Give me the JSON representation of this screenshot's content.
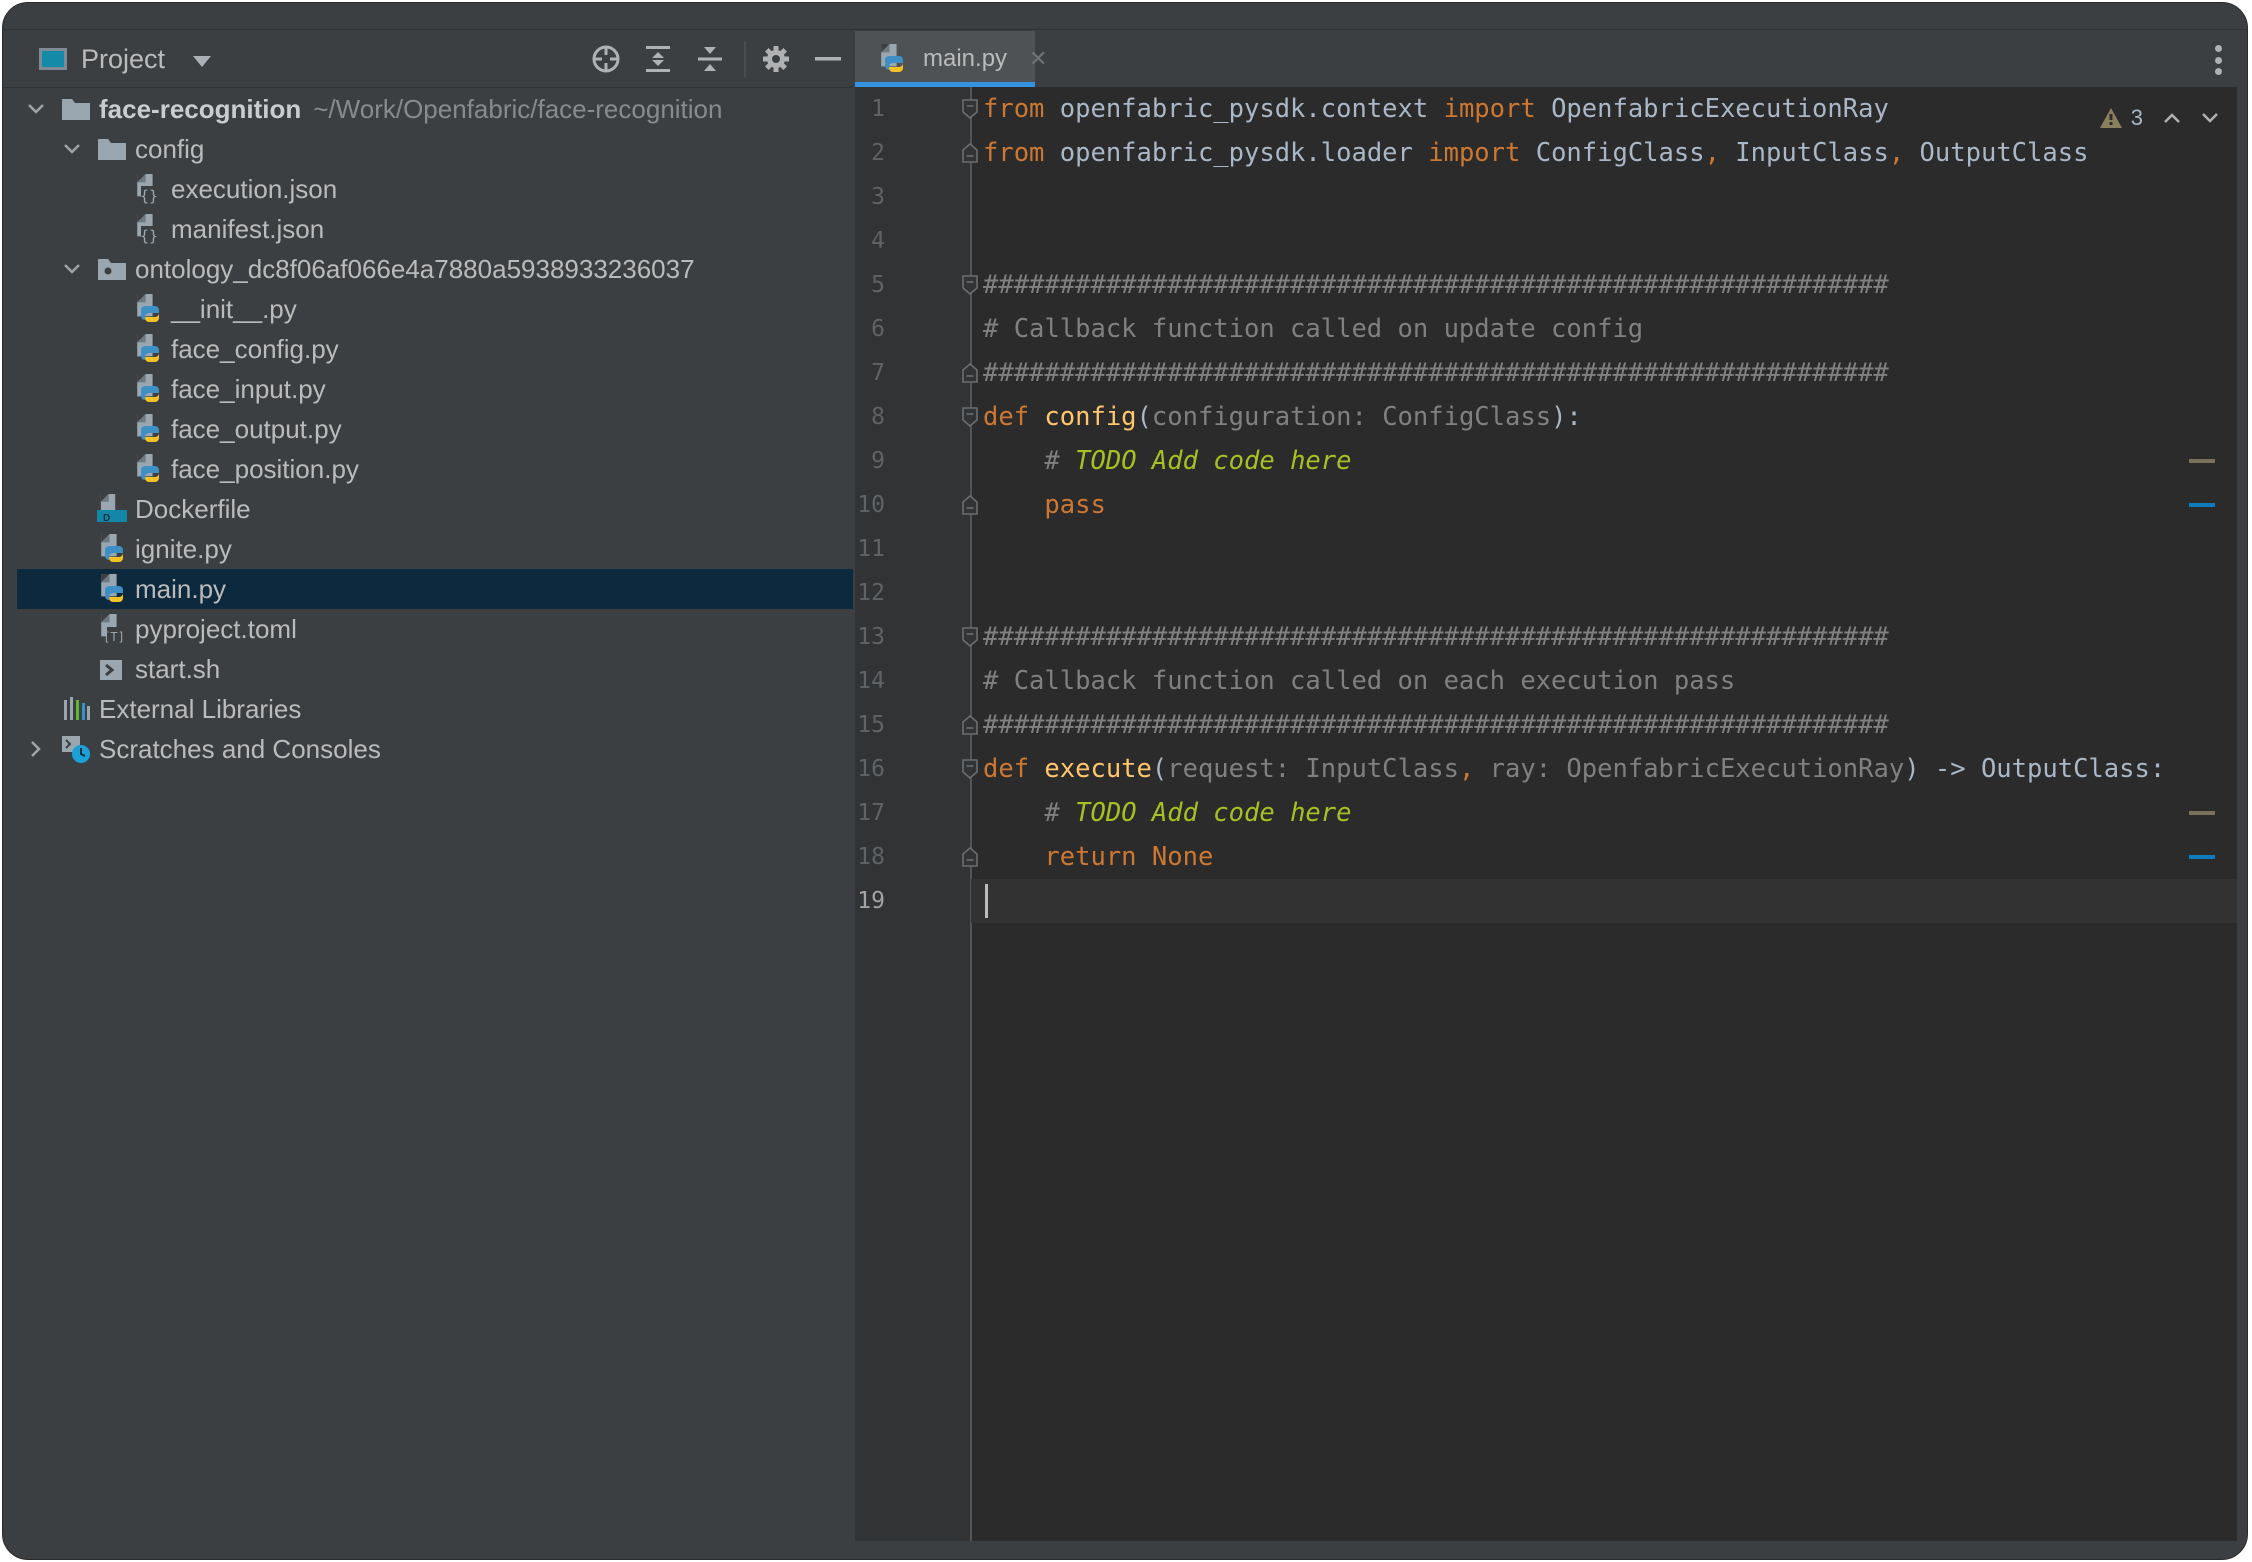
{
  "project_panel": {
    "title": "Project",
    "icons": [
      "locate-icon",
      "expand-all-icon",
      "collapse-all-icon",
      "gear-icon",
      "minimize-icon"
    ]
  },
  "tree": [
    {
      "label": "face-recognition",
      "path": "~/Work/Openfabric/face-recognition",
      "type": "root-folder",
      "depth": 0,
      "expanded": true,
      "bold": true
    },
    {
      "label": "config",
      "type": "folder",
      "depth": 1,
      "expanded": true
    },
    {
      "label": "execution.json",
      "type": "json",
      "depth": 2
    },
    {
      "label": "manifest.json",
      "type": "json",
      "depth": 2
    },
    {
      "label": "ontology_dc8f06af066e4a7880a5938933236037",
      "type": "package",
      "depth": 1,
      "expanded": true
    },
    {
      "label": "__init__.py",
      "type": "python",
      "depth": 2
    },
    {
      "label": "face_config.py",
      "type": "python",
      "depth": 2
    },
    {
      "label": "face_input.py",
      "type": "python",
      "depth": 2
    },
    {
      "label": "face_output.py",
      "type": "python",
      "depth": 2
    },
    {
      "label": "face_position.py",
      "type": "python",
      "depth": 2
    },
    {
      "label": "Dockerfile",
      "type": "docker",
      "depth": 1
    },
    {
      "label": "ignite.py",
      "type": "python",
      "depth": 1
    },
    {
      "label": "main.py",
      "type": "python",
      "depth": 1,
      "selected": true
    },
    {
      "label": "pyproject.toml",
      "type": "toml",
      "depth": 1
    },
    {
      "label": "start.sh",
      "type": "shell",
      "depth": 1
    },
    {
      "label": "External Libraries",
      "type": "libraries",
      "depth": 0
    },
    {
      "label": "Scratches and Consoles",
      "type": "scratches",
      "depth": 0,
      "collapsed": true
    }
  ],
  "editor": {
    "active_tab": "main.py",
    "warnings_count": "3",
    "current_line": 19,
    "lines": [
      [
        [
          "kw",
          "from"
        ],
        [
          "t",
          " openfabric_pysdk.context "
        ],
        [
          "kw",
          "import"
        ],
        [
          "t",
          " OpenfabricExecutionRay"
        ]
      ],
      [
        [
          "kw",
          "from"
        ],
        [
          "t",
          " openfabric_pysdk.loader "
        ],
        [
          "kw",
          "import"
        ],
        [
          "t",
          " ConfigClass"
        ],
        [
          "kw",
          ","
        ],
        [
          "t",
          " InputClass"
        ],
        [
          "kw",
          ","
        ],
        [
          "t",
          " OutputClass"
        ]
      ],
      [],
      [],
      [
        [
          "cm",
          "###########################################################"
        ]
      ],
      [
        [
          "cm",
          "# Callback function called on update config"
        ]
      ],
      [
        [
          "cm",
          "###########################################################"
        ]
      ],
      [
        [
          "kw",
          "def "
        ],
        [
          "fn",
          "config"
        ],
        [
          "t",
          "("
        ],
        [
          "param",
          "configuration: ConfigClass"
        ],
        [
          "t",
          "):"
        ]
      ],
      [
        [
          "t",
          "    "
        ],
        [
          "cm",
          "# "
        ],
        [
          "todo",
          "TODO Add code here"
        ]
      ],
      [
        [
          "t",
          "    "
        ],
        [
          "kw",
          "pass"
        ]
      ],
      [],
      [],
      [
        [
          "cm",
          "###########################################################"
        ]
      ],
      [
        [
          "cm",
          "# Callback function called on each execution pass"
        ]
      ],
      [
        [
          "cm",
          "###########################################################"
        ]
      ],
      [
        [
          "kw",
          "def "
        ],
        [
          "fn",
          "execute"
        ],
        [
          "t",
          "("
        ],
        [
          "param",
          "request: InputClass"
        ],
        [
          "kw",
          ","
        ],
        [
          "param",
          " ray: OpenfabricExecutionRay"
        ],
        [
          "t",
          ") -> OutputClass:"
        ]
      ],
      [
        [
          "t",
          "    "
        ],
        [
          "cm",
          "# "
        ],
        [
          "todo",
          "TODO Add code here"
        ]
      ],
      [
        [
          "t",
          "    "
        ],
        [
          "kw",
          "return"
        ],
        [
          "t",
          " "
        ],
        [
          "kw",
          "None"
        ]
      ],
      []
    ],
    "fold_markers": {
      "1": "start",
      "2": "end",
      "5": "start",
      "7": "end",
      "8": "start",
      "10": "end",
      "13": "start",
      "15": "end",
      "16": "start",
      "18": "end"
    },
    "error_stripe_marks": [
      {
        "line": 9,
        "kind": "todo",
        "color": "#7a7259"
      },
      {
        "line": 10,
        "kind": "change",
        "color": "#0e7bbf"
      },
      {
        "line": 17,
        "kind": "todo",
        "color": "#7a7259"
      },
      {
        "line": 18,
        "kind": "change",
        "color": "#0e7bbf"
      }
    ]
  },
  "colors": {
    "selection": "#0d293e",
    "tab_underline": "#3592e0",
    "keyword": "#cc7832",
    "function": "#ffc66d",
    "comment": "#808080",
    "todo": "#a8c023"
  }
}
